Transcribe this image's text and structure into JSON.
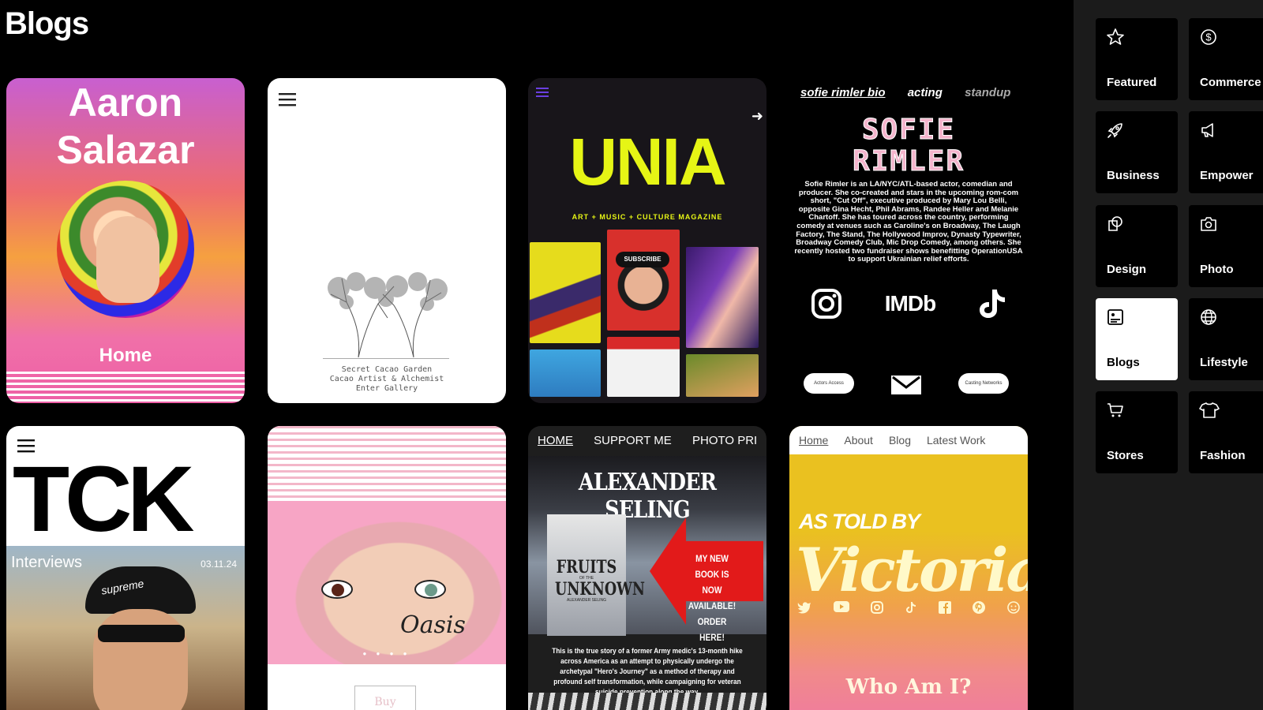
{
  "page": {
    "title": "Blogs"
  },
  "cards": {
    "aaron": {
      "name_line1": "Aaron",
      "name_line2": "Salazar",
      "link": "Home"
    },
    "garden": {
      "line1": "Secret Cacao Garden",
      "line2": "Cacao Artist & Alchemist",
      "line3": "Enter Gallery"
    },
    "unia": {
      "title": "UNIA",
      "tagline": "ART + MUSIC + CULTURE MAGAZINE",
      "subscribe": "SUBSCRIBE"
    },
    "sofie": {
      "nav": [
        "sofie rimler bio",
        "acting",
        "standup"
      ],
      "name_line1": "SOFIE",
      "name_line2": "RIMLER",
      "bio": "Sofie Rimler is an LA/NYC/ATL-based actor, comedian and producer. She co-created and stars in the upcoming rom-com short, \"Cut Off\", executive produced by Mary Lou Belli, opposite Gina Hecht, Phil Abrams, Randee Heller and Melanie Chartoff. She has toured across the country, performing comedy at venues such as Caroline's on Broadway, The Laugh Factory, The Stand, The Hollywood Improv, Dynasty Typewriter, Broadway Comedy Club, Mic Drop Comedy, among others. She recently hosted two fundraiser shows benefitting OperationUSA to support Ukrainian relief efforts.",
      "imdb": "IMDb",
      "pill_left": "Actors Access",
      "pill_right": "Casting Networks"
    },
    "tck": {
      "logo": "TCK",
      "section": "Interviews",
      "date": "03.11.24",
      "cap_text": "supreme"
    },
    "oasis": {
      "script": "Oasis",
      "buy": "Buy"
    },
    "seling": {
      "nav": [
        "HOME",
        "SUPPORT ME",
        "PHOTO PRI"
      ],
      "title": "ALEXANDER SELING",
      "book_title_1": "FRUITS",
      "book_title_2": "OF THE",
      "book_title_3": "UNKNOWN",
      "book_author": "ALEXANDER SELING",
      "banner_1": "MY NEW BOOK IS",
      "banner_2": "NOW AVAILABLE!",
      "banner_3": "ORDER HERE!",
      "desc": "This is the true story of a former Army medic's 13-month hike across America as an attempt to physically undergo the archetypal \"Hero's Journey\" as a method of therapy and profound self transformation, while campaigning for veteran suicide prevention along the way."
    },
    "victoria": {
      "nav": [
        "Home",
        "About",
        "Blog",
        "Latest Work"
      ],
      "as_told_by": "AS TOLD BY",
      "name": "Victoria",
      "who": "Who Am I?"
    }
  },
  "categories": [
    {
      "label": "Featured",
      "icon": "star-icon",
      "active": false
    },
    {
      "label": "Commerce",
      "icon": "dollar-icon",
      "active": false
    },
    {
      "label": "Business",
      "icon": "rocket-icon",
      "active": false
    },
    {
      "label": "Empower",
      "icon": "megaphone-icon",
      "active": false
    },
    {
      "label": "Design",
      "icon": "shapes-icon",
      "active": false
    },
    {
      "label": "Photo",
      "icon": "camera-icon",
      "active": false
    },
    {
      "label": "Blogs",
      "icon": "blog-icon",
      "active": true
    },
    {
      "label": "Lifestyle",
      "icon": "globe-icon",
      "active": false
    },
    {
      "label": "Stores",
      "icon": "cart-icon",
      "active": false
    },
    {
      "label": "Fashion",
      "icon": "tshirt-icon",
      "active": false
    }
  ],
  "colors": {
    "background": "#000000",
    "panel": "#1b1b1b",
    "unia_accent": "#e6f515",
    "seling_red": "#e21a1a"
  }
}
